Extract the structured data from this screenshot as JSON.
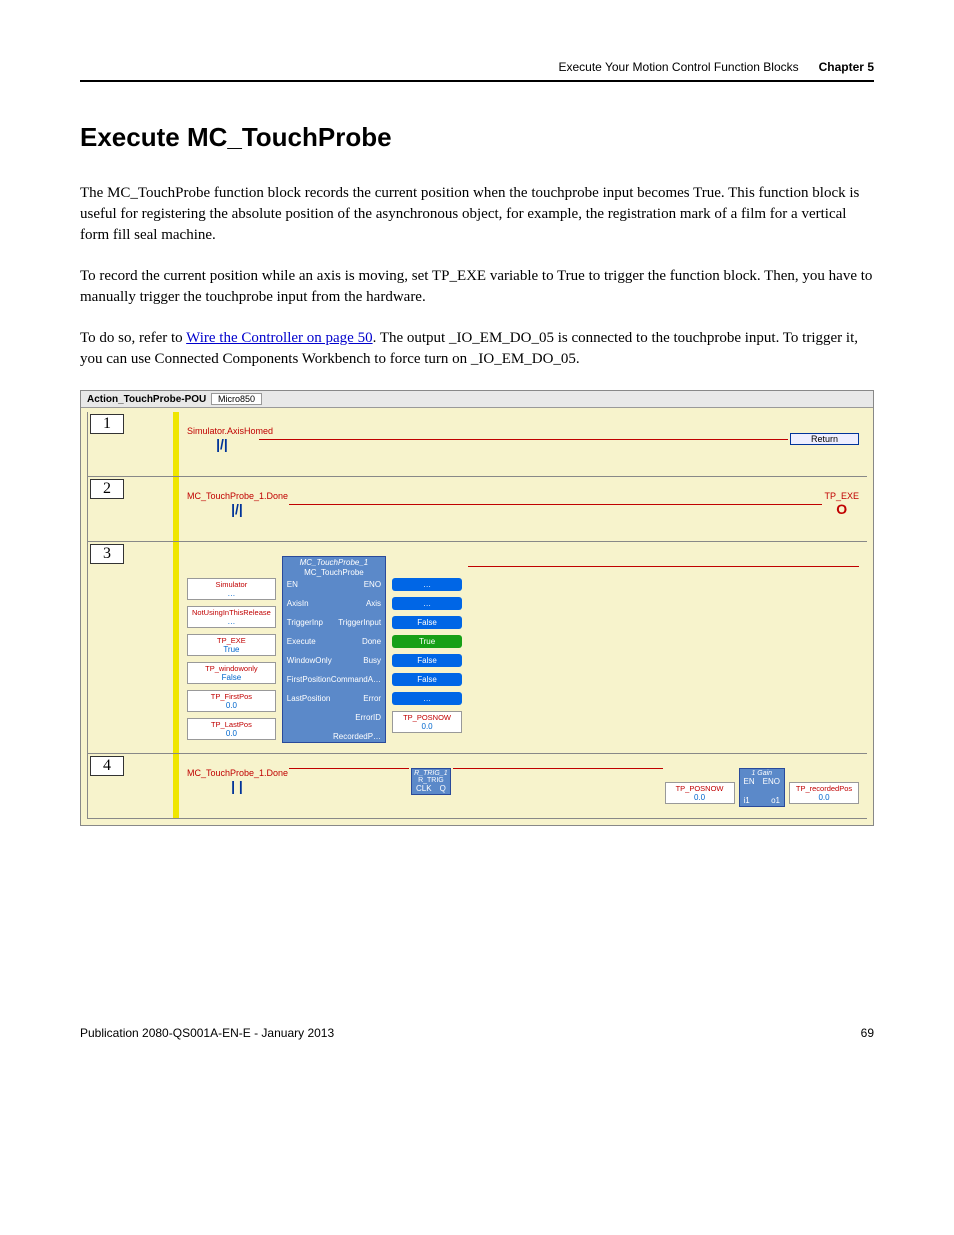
{
  "header": {
    "section": "Execute Your Motion Control Function Blocks",
    "chapter": "Chapter 5"
  },
  "title": "Execute MC_TouchProbe",
  "paragraphs": {
    "p1": "The MC_TouchProbe function block records the current position when the touchprobe input becomes True. This function block is useful for registering the absolute position of the asynchronous object, for example, the registration mark of a film for a vertical form fill seal machine.",
    "p2": "To record the current position while an axis is moving, set TP_EXE variable to True to trigger the function block. Then, you have to manually trigger the touchprobe input from the hardware.",
    "p3a": "To do so, refer to ",
    "p3link": "Wire the Controller on page 50",
    "p3b": ". The output _IO_EM_DO_05 is connected to the touchprobe input. To trigger it, you can use Connected Components Workbench to force turn on _IO_EM_DO_05."
  },
  "ladder": {
    "tabTitle": "Action_TouchProbe-POU",
    "subTab": "Micro850",
    "rung1": {
      "num": "1",
      "contact": "Simulator.AxisHomed",
      "contactSymbol": "|/|",
      "coil": "Return"
    },
    "rung2": {
      "num": "2",
      "contact": "MC_TouchProbe_1.Done",
      "contactSymbol": "|/|",
      "coilLabel": "TP_EXE",
      "coilSymbol": "O"
    },
    "rung3": {
      "num": "3",
      "fbName": "MC_TouchProbe_1",
      "fbType": "MC_TouchProbe",
      "ports": {
        "en": "EN",
        "eno": "ENO",
        "axisin": "AxisIn",
        "axis": "Axis",
        "triggerinp": "TriggerInp",
        "triggerinput": "TriggerInput",
        "execute": "Execute",
        "done": "Done",
        "windowonly": "WindowOnly",
        "busy": "Busy",
        "firstposition": "FirstPosition",
        "commandab": "CommandA…",
        "lastposition": "LastPosition",
        "error": "Error",
        "errorid": "ErrorID",
        "recordedp": "RecordedP…"
      },
      "inputs": [
        {
          "lbl": "Simulator",
          "val": "…"
        },
        {
          "lbl": "NotUsingInThisRelease",
          "val": "…"
        },
        {
          "lbl": "TP_EXE",
          "val": "True"
        },
        {
          "lbl": "TP_windowonly",
          "val": "False"
        },
        {
          "lbl": "TP_FirstPos",
          "val": "0.0"
        },
        {
          "lbl": "TP_LastPos",
          "val": "0.0"
        }
      ],
      "outputs": [
        {
          "val": "…",
          "cls": "out-box"
        },
        {
          "val": "…",
          "cls": "out-box"
        },
        {
          "val": "False",
          "cls": "out-box"
        },
        {
          "val": "True",
          "cls": "out-box green"
        },
        {
          "val": "False",
          "cls": "out-box"
        },
        {
          "val": "False",
          "cls": "out-box"
        },
        {
          "val": "…",
          "cls": "out-box"
        }
      ],
      "recorded": {
        "lbl": "TP_POSNOW",
        "val": "0.0"
      }
    },
    "rung4": {
      "num": "4",
      "contact": "MC_TouchProbe_1.Done",
      "contactSymbol": "| |",
      "rtrig": {
        "name": "R_TRIG_1",
        "type": "R_TRIG",
        "in": "CLK",
        "out": "Q"
      },
      "gain": {
        "name": "1 Gain",
        "in1": "EN",
        "out1": "ENO",
        "in2": "i1",
        "out2": "o1"
      },
      "inval": {
        "lbl": "TP_POSNOW",
        "val": "0.0"
      },
      "outval": {
        "lbl": "TP_recordedPos",
        "val": "0.0"
      }
    }
  },
  "footer": {
    "pub": "Publication 2080-QS001A-EN-E - January 2013",
    "page": "69"
  }
}
